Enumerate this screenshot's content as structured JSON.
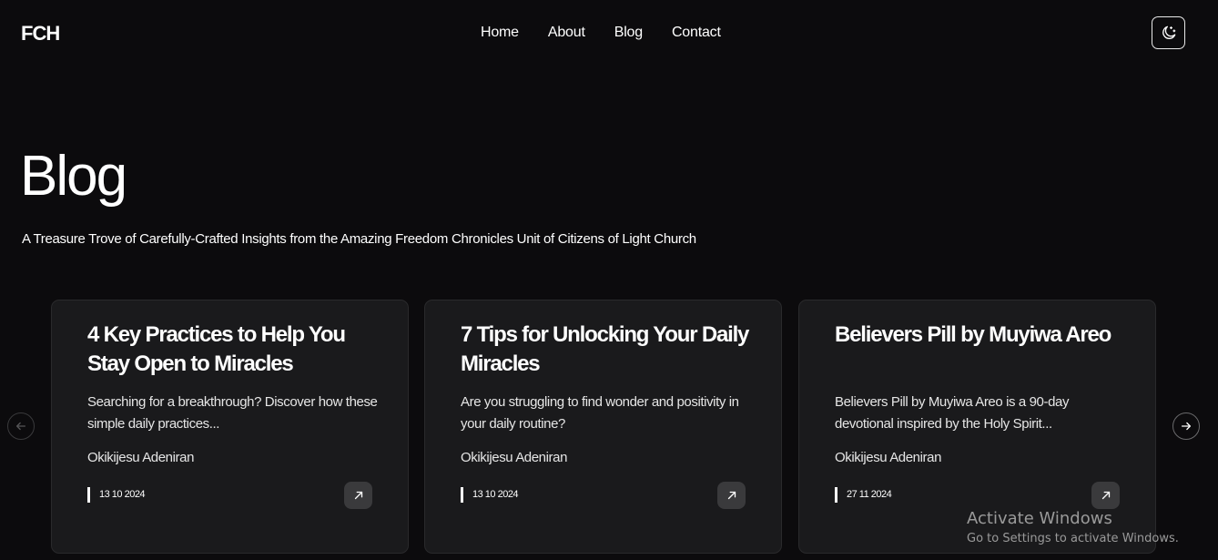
{
  "header": {
    "logo": "FCH",
    "nav": [
      "Home",
      "About",
      "Blog",
      "Contact"
    ],
    "theme_toggle_icon": "moon-stars-icon"
  },
  "hero": {
    "title": "Blog",
    "subtitle": "A Treasure Trove of Carefully-Crafted Insights from the Amazing Freedom Chronicles Unit of Citizens of Light Church"
  },
  "posts": [
    {
      "title": "4 Key Practices to Help You Stay Open to Miracles",
      "excerpt": "Searching for a breakthrough? Discover how these simple daily practices...",
      "author": "Okikijesu Adeniran",
      "date": "13 10 2024"
    },
    {
      "title": "7 Tips for Unlocking Your Daily Miracles",
      "excerpt": "Are you struggling to find wonder and positivity in your daily routine?",
      "author": "Okikijesu Adeniran",
      "date": "13 10 2024"
    },
    {
      "title": "Believers Pill by Muyiwa Areo",
      "excerpt": "Believers Pill by Muyiwa Areo is a 90-day devotional inspired by the Holy Spirit...",
      "author": "Okikijesu Adeniran",
      "date": "27 11 2024"
    }
  ],
  "carousel": {
    "prev_icon": "arrow-left-icon",
    "next_icon": "arrow-right-icon"
  },
  "watermark": {
    "title": "Activate Windows",
    "subtitle": "Go to Settings to activate Windows."
  },
  "colors": {
    "background": "#0c0b0d",
    "card": "#1a1a1c",
    "text": "#ffffff"
  }
}
